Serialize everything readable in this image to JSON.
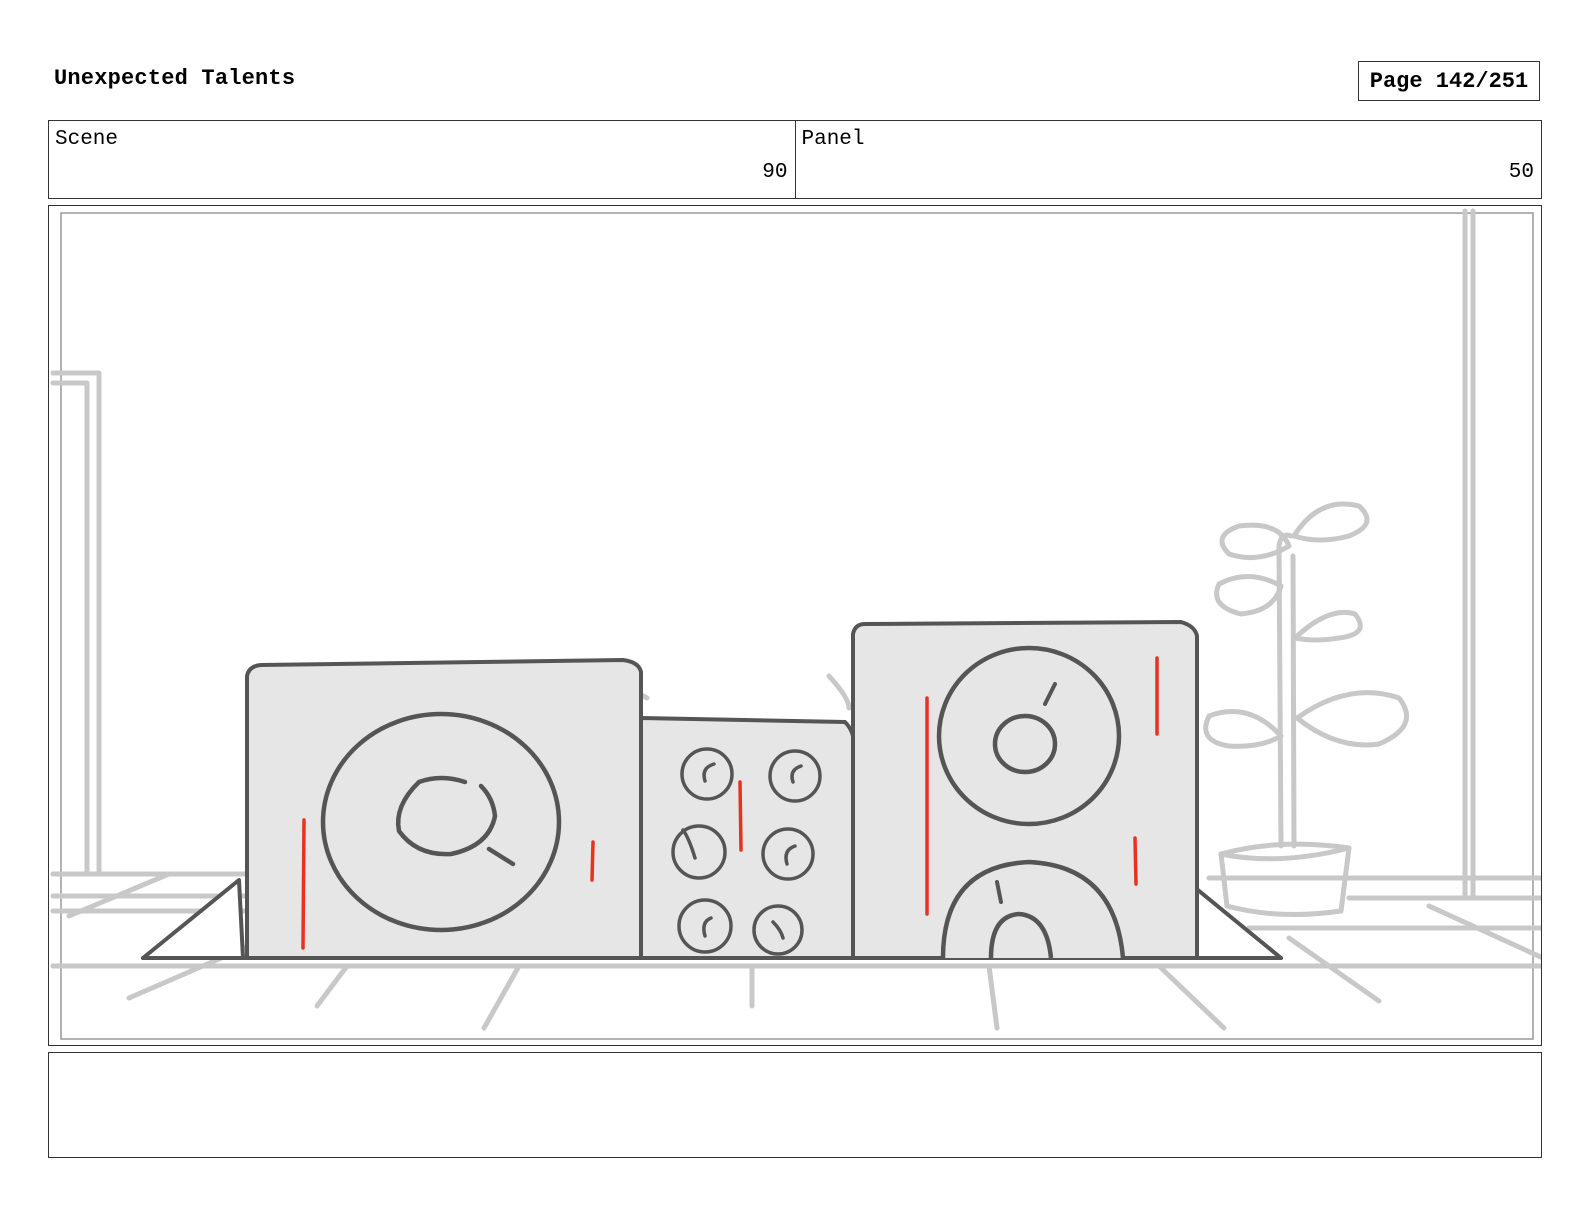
{
  "header": {
    "title": "Unexpected Talents",
    "page_label": "Page 142/251"
  },
  "info": {
    "scene_label": "Scene",
    "scene_value": "90",
    "panel_label": "Panel",
    "panel_value": "50"
  },
  "drawing": {
    "description_icon": "storyboard-sketch-speakers",
    "colors": {
      "outline": "#555555",
      "fill": "#e6e6e6",
      "background_sketch": "#c8c8c8",
      "accent": "#e8321e",
      "frame": "#999999"
    }
  },
  "notes": {
    "text": ""
  }
}
